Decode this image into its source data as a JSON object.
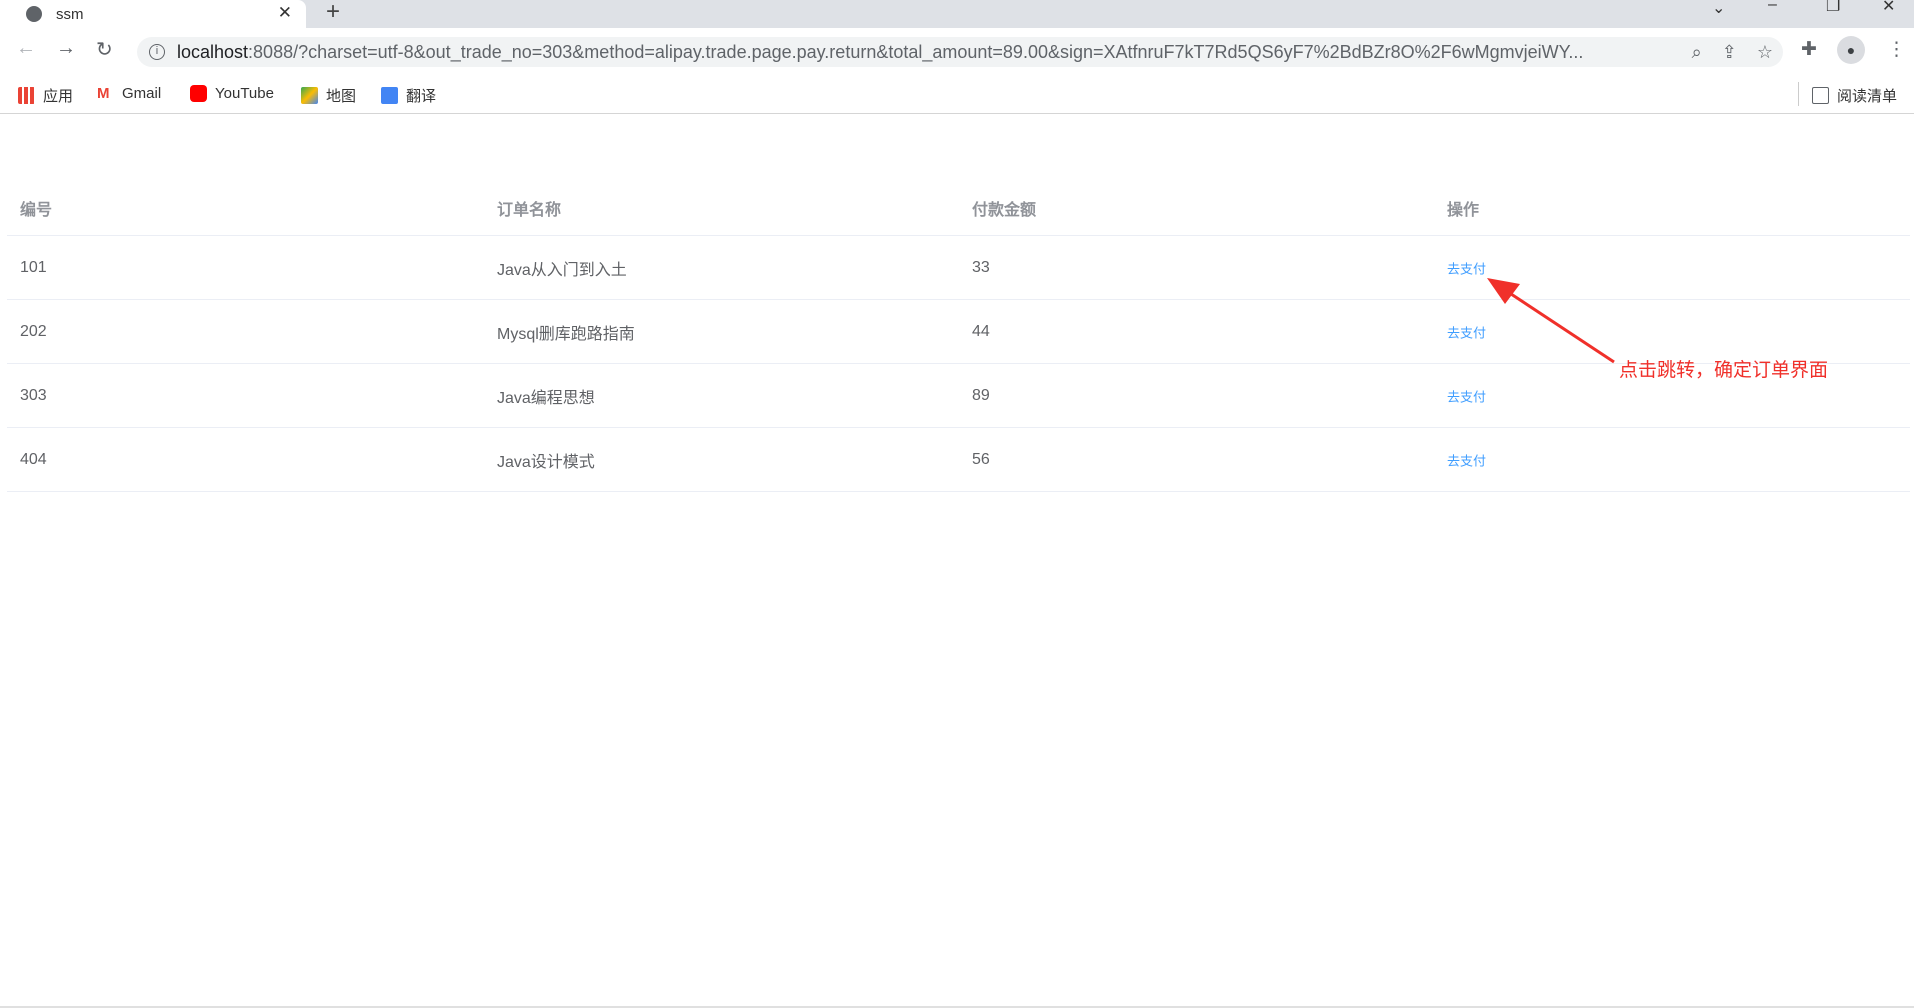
{
  "browser": {
    "tab_title": "ssm",
    "url_host": "localhost",
    "url_rest": ":8088/?charset=utf-8&out_trade_no=303&method=alipay.trade.page.pay.return&total_amount=89.00&sign=XAtfnruF7kT7Rd5QS6yF7%2BdBZr8O%2F6wMgmvjeiWY...",
    "bookmarks": [
      {
        "label": "应用",
        "icon": "apps-grid-icon"
      },
      {
        "label": "Gmail",
        "icon": "gmail-icon"
      },
      {
        "label": "YouTube",
        "icon": "youtube-icon"
      },
      {
        "label": "地图",
        "icon": "maps-icon"
      },
      {
        "label": "翻译",
        "icon": "translate-icon"
      }
    ],
    "reading_list": "阅读清单"
  },
  "table": {
    "headers": [
      "编号",
      "订单名称",
      "付款金额",
      "操作"
    ],
    "rows": [
      {
        "id": "101",
        "name": "Java从入门到入土",
        "amount": "33",
        "action": "去支付"
      },
      {
        "id": "202",
        "name": "Mysql删库跑路指南",
        "amount": "44",
        "action": "去支付"
      },
      {
        "id": "303",
        "name": "Java编程思想",
        "amount": "89",
        "action": "去支付"
      },
      {
        "id": "404",
        "name": "Java设计模式",
        "amount": "56",
        "action": "去支付"
      }
    ]
  },
  "annotation": {
    "text": "点击跳转，确定订单界面",
    "color": "#f0302a"
  },
  "colors": {
    "link": "#409eff"
  }
}
